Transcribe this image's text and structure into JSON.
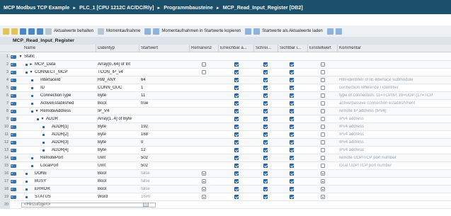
{
  "breadcrumb": [
    "MCP Modbus TCP Example",
    "PLC_1 [CPU 1212C AC/DC/Rly]",
    "Programmbausteine",
    "MCP_Read_Input_Register [DB2]"
  ],
  "toolbar": {
    "labels": [
      "Aktualwerte behalten",
      "Momentaufnahme",
      "Momentaufnahmen in Startwerte kopieren",
      "Startwerte als Aktualwerte laden"
    ]
  },
  "block_title": "MCP_Read_Input_Register",
  "columns": [
    "Name",
    "Datentyp",
    "Startwert",
    "Remanenz",
    "Erreichbar a...",
    "Schrei...",
    "Sichtbar i...",
    "Einstellwert",
    "Kommentar"
  ],
  "rows": [
    {
      "num": "1",
      "icon": true,
      "tri": "▼",
      "bullet": false,
      "indent": 0,
      "name": "Static",
      "type": "",
      "start": "",
      "rem": "",
      "err": "",
      "sch": "",
      "sic": "",
      "ein": "",
      "comment": "",
      "grey": false
    },
    {
      "num": "2",
      "icon": true,
      "tri": "►",
      "bullet": true,
      "indent": 1,
      "name": "MCP_Data",
      "type": "Array[0..64] of Int",
      "start": "",
      "rem": "off",
      "err": "on",
      "sch": "on",
      "sic": "on",
      "ein": "off",
      "comment": "",
      "grey": false
    },
    {
      "num": "3",
      "icon": true,
      "tri": "▼",
      "bullet": true,
      "indent": 1,
      "name": "CONNECT_MCP",
      "type": "TCON_IP_v4",
      "start": "",
      "rem": "off",
      "err": "on",
      "sch": "on",
      "sic": "on",
      "ein": "off",
      "comment": "",
      "grey": false
    },
    {
      "num": "4",
      "icon": true,
      "tri": "",
      "bullet": true,
      "indent": 2,
      "name": "InterfaceId",
      "type": "HW_ANY",
      "start": "64",
      "rem": "",
      "err": "on",
      "sch": "on",
      "sic": "on",
      "ein": "off",
      "comment": "HW-identifier of IE-interface submodule",
      "grey": false
    },
    {
      "num": "5",
      "icon": true,
      "tri": "",
      "bullet": true,
      "indent": 2,
      "name": "ID",
      "type": "CONN_OUC",
      "start": "1",
      "rem": "",
      "err": "on",
      "sch": "on",
      "sic": "on",
      "ein": "off",
      "comment": "connection reference / identifier",
      "grey": false
    },
    {
      "num": "6",
      "icon": true,
      "tri": "",
      "bullet": true,
      "indent": 2,
      "name": "ConnectionType",
      "type": "Byte",
      "start": "11",
      "rem": "",
      "err": "on",
      "sch": "on",
      "sic": "on",
      "ein": "off",
      "comment": "type of connection: 11=TCP/IP, 19=UDP (17=TCP",
      "grey": false
    },
    {
      "num": "7",
      "icon": true,
      "tri": "",
      "bullet": true,
      "indent": 2,
      "name": "ActiveEstablished",
      "type": "Bool",
      "start": "true",
      "rem": "",
      "err": "on",
      "sch": "on",
      "sic": "on",
      "ein": "off",
      "comment": "active/passive connection establishment",
      "grey": false
    },
    {
      "num": "8",
      "icon": true,
      "tri": "▼",
      "bullet": true,
      "indent": 2,
      "name": "RemoteAddress",
      "type": "IP_V4",
      "start": "",
      "rem": "",
      "err": "on",
      "sch": "on",
      "sic": "on",
      "ein": "off",
      "comment": "remote IP address (IPv4)",
      "grey": false
    },
    {
      "num": "9",
      "icon": true,
      "tri": "▼",
      "bullet": true,
      "indent": 3,
      "name": "ADDR",
      "type": "Array[1..4] of Byte",
      "start": "",
      "rem": "",
      "err": "on",
      "sch": "on",
      "sic": "on",
      "ein": "off",
      "comment": "IPv4 address",
      "grey": false
    },
    {
      "num": "10",
      "icon": true,
      "tri": "",
      "bullet": true,
      "indent": 4,
      "name": "ADDR[1]",
      "type": "Byte",
      "start": "192",
      "rem": "",
      "err": "on",
      "sch": "on",
      "sic": "on",
      "ein": "off",
      "comment": "IPv4 address",
      "grey": false
    },
    {
      "num": "11",
      "icon": true,
      "tri": "",
      "bullet": true,
      "indent": 4,
      "name": "ADDR[2]",
      "type": "Byte",
      "start": "168",
      "rem": "",
      "err": "on",
      "sch": "on",
      "sic": "on",
      "ein": "off",
      "comment": "IPv4 address",
      "grey": false
    },
    {
      "num": "12",
      "icon": true,
      "tri": "",
      "bullet": true,
      "indent": 4,
      "name": "ADDR[3]",
      "type": "Byte",
      "start": "0",
      "rem": "",
      "err": "on",
      "sch": "on",
      "sic": "on",
      "ein": "off",
      "comment": "IPv4 address",
      "grey": false
    },
    {
      "num": "13",
      "icon": true,
      "tri": "",
      "bullet": true,
      "indent": 4,
      "name": "ADDR[4]",
      "type": "Byte",
      "start": "12",
      "rem": "",
      "err": "on",
      "sch": "on",
      "sic": "on",
      "ein": "off",
      "comment": "IPv4 address",
      "grey": false
    },
    {
      "num": "14",
      "icon": true,
      "tri": "",
      "bullet": true,
      "indent": 2,
      "name": "RemotePort",
      "type": "UInt",
      "start": "502",
      "rem": "",
      "err": "on",
      "sch": "on",
      "sic": "on",
      "ein": "off",
      "comment": "remote UDP/TCP port number",
      "grey": false
    },
    {
      "num": "15",
      "icon": true,
      "tri": "",
      "bullet": true,
      "indent": 2,
      "name": "LocalPort",
      "type": "UInt",
      "start": "502",
      "rem": "",
      "err": "on",
      "sch": "on",
      "sic": "on",
      "ein": "off",
      "comment": "local UDP/TCP port number",
      "grey": false
    },
    {
      "num": "16",
      "icon": true,
      "tri": "",
      "bullet": true,
      "indent": 1,
      "name": "DONE",
      "type": "Bool",
      "start": "false",
      "rem": "mixed",
      "err": "on",
      "sch": "on",
      "sic": "on",
      "ein": "mixed",
      "comment": "",
      "grey": true
    },
    {
      "num": "17",
      "icon": true,
      "tri": "",
      "bullet": true,
      "indent": 1,
      "name": "BUSY",
      "type": "Bool",
      "start": "false",
      "rem": "mixed",
      "err": "on",
      "sch": "on",
      "sic": "on",
      "ein": "mixed",
      "comment": "",
      "grey": true
    },
    {
      "num": "18",
      "icon": true,
      "tri": "",
      "bullet": true,
      "indent": 1,
      "name": "ERROR",
      "type": "Bool",
      "start": "false",
      "rem": "mixed",
      "err": "on",
      "sch": "on",
      "sic": "on",
      "ein": "mixed",
      "comment": "",
      "grey": true
    },
    {
      "num": "19",
      "icon": true,
      "tri": "",
      "bullet": true,
      "indent": 1,
      "name": "STATUS",
      "type": "Word",
      "start": "16#0",
      "rem": "mixed",
      "err": "on",
      "sch": "on",
      "sic": "on",
      "ein": "mixed",
      "comment": "",
      "grey": true
    }
  ],
  "add_row": {
    "num": "20",
    "placeholder": "<Hinzufügen>"
  },
  "colors": {
    "titlebar": "#1b4f6a",
    "checkbox_on": "#2a6fbf"
  }
}
